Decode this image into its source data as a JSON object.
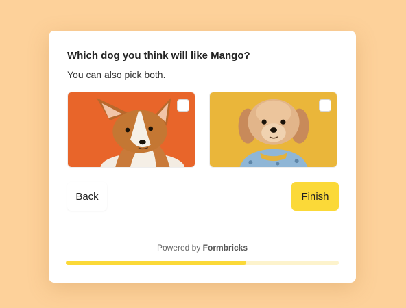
{
  "survey": {
    "question": "Which dog you think will like Mango?",
    "subtitle": "You can also pick both.",
    "options": [
      {
        "name": "corgi-puppy-photo",
        "background": "#e8652a",
        "checked": false
      },
      {
        "name": "fluffy-dog-photo",
        "background": "#eab63a",
        "checked": false
      }
    ]
  },
  "navigation": {
    "back_label": "Back",
    "finish_label": "Finish"
  },
  "footer": {
    "powered_prefix": "Powered by",
    "brand": "Formbricks"
  },
  "progress": {
    "fraction": 0.66
  },
  "colors": {
    "page_background": "#fdd19a",
    "accent": "#fbd938",
    "progress_track": "#fdf3cc"
  }
}
